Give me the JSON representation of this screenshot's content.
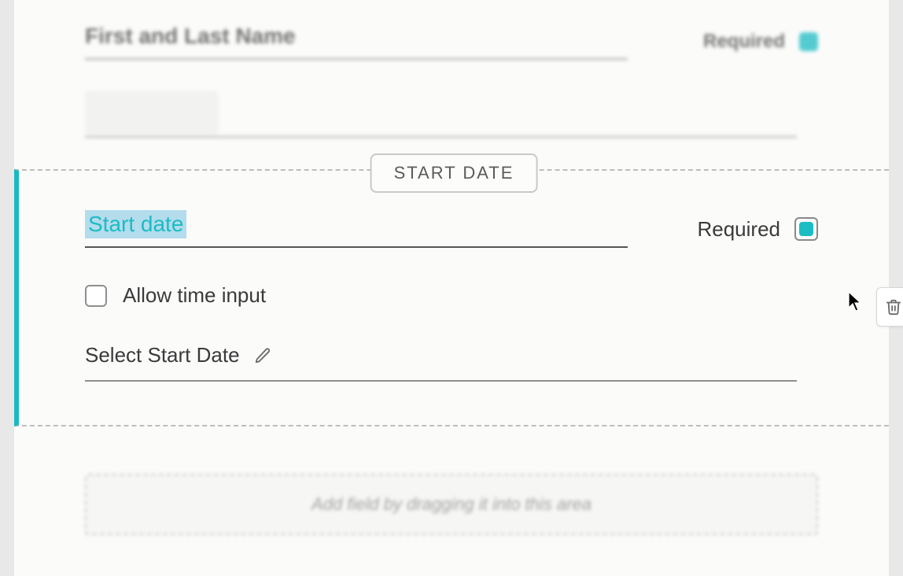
{
  "name_field": {
    "label": "First and Last Name",
    "required_text": "Required",
    "required_checked": true
  },
  "start_date_field": {
    "badge": "START DATE",
    "label_value": "Start date",
    "required_text": "Required",
    "required_checked": true,
    "allow_time_label": "Allow time input",
    "allow_time_checked": false,
    "placeholder_label": "Select Start Date"
  },
  "drop_zone": {
    "hint": "Add field by dragging it into this area"
  }
}
